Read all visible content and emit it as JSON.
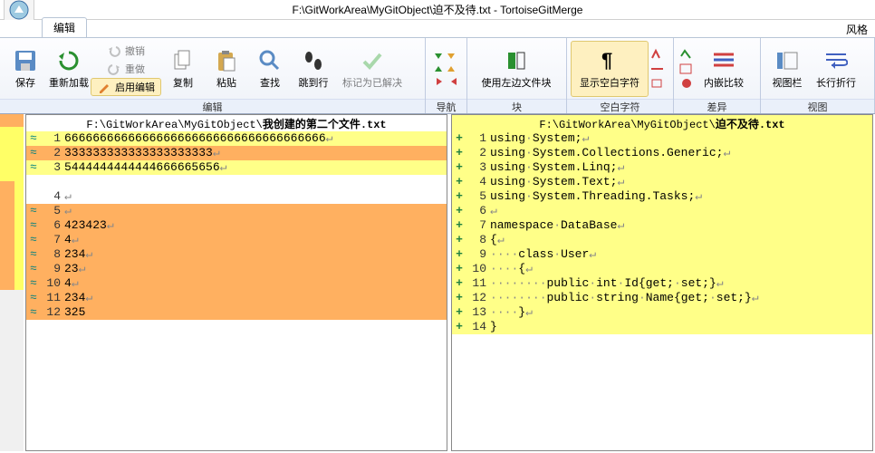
{
  "title": "F:\\GitWorkArea\\MyGitObject\\迫不及待.txt - TortoiseGitMerge",
  "tabs": {
    "edit": "编辑",
    "aux": "风格"
  },
  "ribbon": {
    "save": "保存",
    "reload": "重新加载",
    "undo": "撤销",
    "redo": "重做",
    "enableEdit": "启用编辑",
    "copy": "复制",
    "paste": "粘贴",
    "find": "查找",
    "gotoLine": "跳到行",
    "markResolved": "标记为已解决",
    "useLeft": "使用左边文件块",
    "showWhitespace": "显示空白字符",
    "inlineDiff": "内嵌比较",
    "viewBar": "视图栏",
    "wrapLong": "长行折行",
    "groups": {
      "edit": "编辑",
      "nav": "导航",
      "block": "块",
      "whitespace": "空白字符",
      "diff": "差异",
      "view": "视图"
    }
  },
  "leftPane": {
    "pathPrefix": "F:\\GitWorkArea\\MyGitObject\\",
    "pathBold": "我创建的第二个文件.txt",
    "lines": [
      {
        "n": 1,
        "mark": "≈",
        "bg": "yellow",
        "t": "6666666666666666666666666666666666666↵"
      },
      {
        "n": 2,
        "mark": "≈",
        "bg": "orange",
        "t": "333333333333333333333↵"
      },
      {
        "n": 3,
        "mark": "≈",
        "bg": "yellow",
        "t": "5444444444444666665656↵"
      },
      {
        "n": null,
        "mark": "",
        "bg": "white",
        "t": ""
      },
      {
        "n": 4,
        "mark": "",
        "bg": "white",
        "t": "↵"
      },
      {
        "n": 5,
        "mark": "≈",
        "bg": "orange",
        "t": "↵"
      },
      {
        "n": 6,
        "mark": "≈",
        "bg": "orange",
        "t": "423423↵"
      },
      {
        "n": 7,
        "mark": "≈",
        "bg": "orange",
        "t": "4↵"
      },
      {
        "n": 8,
        "mark": "≈",
        "bg": "orange",
        "t": "234↵"
      },
      {
        "n": 9,
        "mark": "≈",
        "bg": "orange",
        "t": "23↵"
      },
      {
        "n": 10,
        "mark": "≈",
        "bg": "orange",
        "t": "4↵"
      },
      {
        "n": 11,
        "mark": "≈",
        "bg": "orange",
        "t": "234↵"
      },
      {
        "n": 12,
        "mark": "≈",
        "bg": "orange",
        "t": "325"
      }
    ]
  },
  "rightPane": {
    "pathPrefix": "F:\\GitWorkArea\\MyGitObject\\",
    "pathBold": "迫不及待.txt",
    "lines": [
      {
        "n": 1,
        "mark": "+",
        "bg": "yellow",
        "t": "using·System;↵"
      },
      {
        "n": 2,
        "mark": "+",
        "bg": "yellow",
        "t": "using·System.Collections.Generic;↵"
      },
      {
        "n": 3,
        "mark": "+",
        "bg": "yellow",
        "t": "using·System.Linq;↵"
      },
      {
        "n": 4,
        "mark": "+",
        "bg": "yellow",
        "t": "using·System.Text;↵"
      },
      {
        "n": 5,
        "mark": "+",
        "bg": "yellow",
        "t": "using·System.Threading.Tasks;↵"
      },
      {
        "n": 6,
        "mark": "+",
        "bg": "yellow",
        "t": "↵"
      },
      {
        "n": 7,
        "mark": "+",
        "bg": "yellow",
        "t": "namespace·DataBase↵"
      },
      {
        "n": 8,
        "mark": "+",
        "bg": "yellow",
        "t": "{↵"
      },
      {
        "n": 9,
        "mark": "+",
        "bg": "yellow",
        "t": "····class·User↵"
      },
      {
        "n": 10,
        "mark": "+",
        "bg": "yellow",
        "t": "····{↵"
      },
      {
        "n": 11,
        "mark": "+",
        "bg": "yellow",
        "t": "········public·int·Id{get;·set;}↵"
      },
      {
        "n": 12,
        "mark": "+",
        "bg": "yellow",
        "t": "········public·string·Name{get;·set;}↵"
      },
      {
        "n": 13,
        "mark": "+",
        "bg": "yellow",
        "t": "····}↵"
      },
      {
        "n": 14,
        "mark": "+",
        "bg": "yellow",
        "t": "}"
      }
    ]
  }
}
